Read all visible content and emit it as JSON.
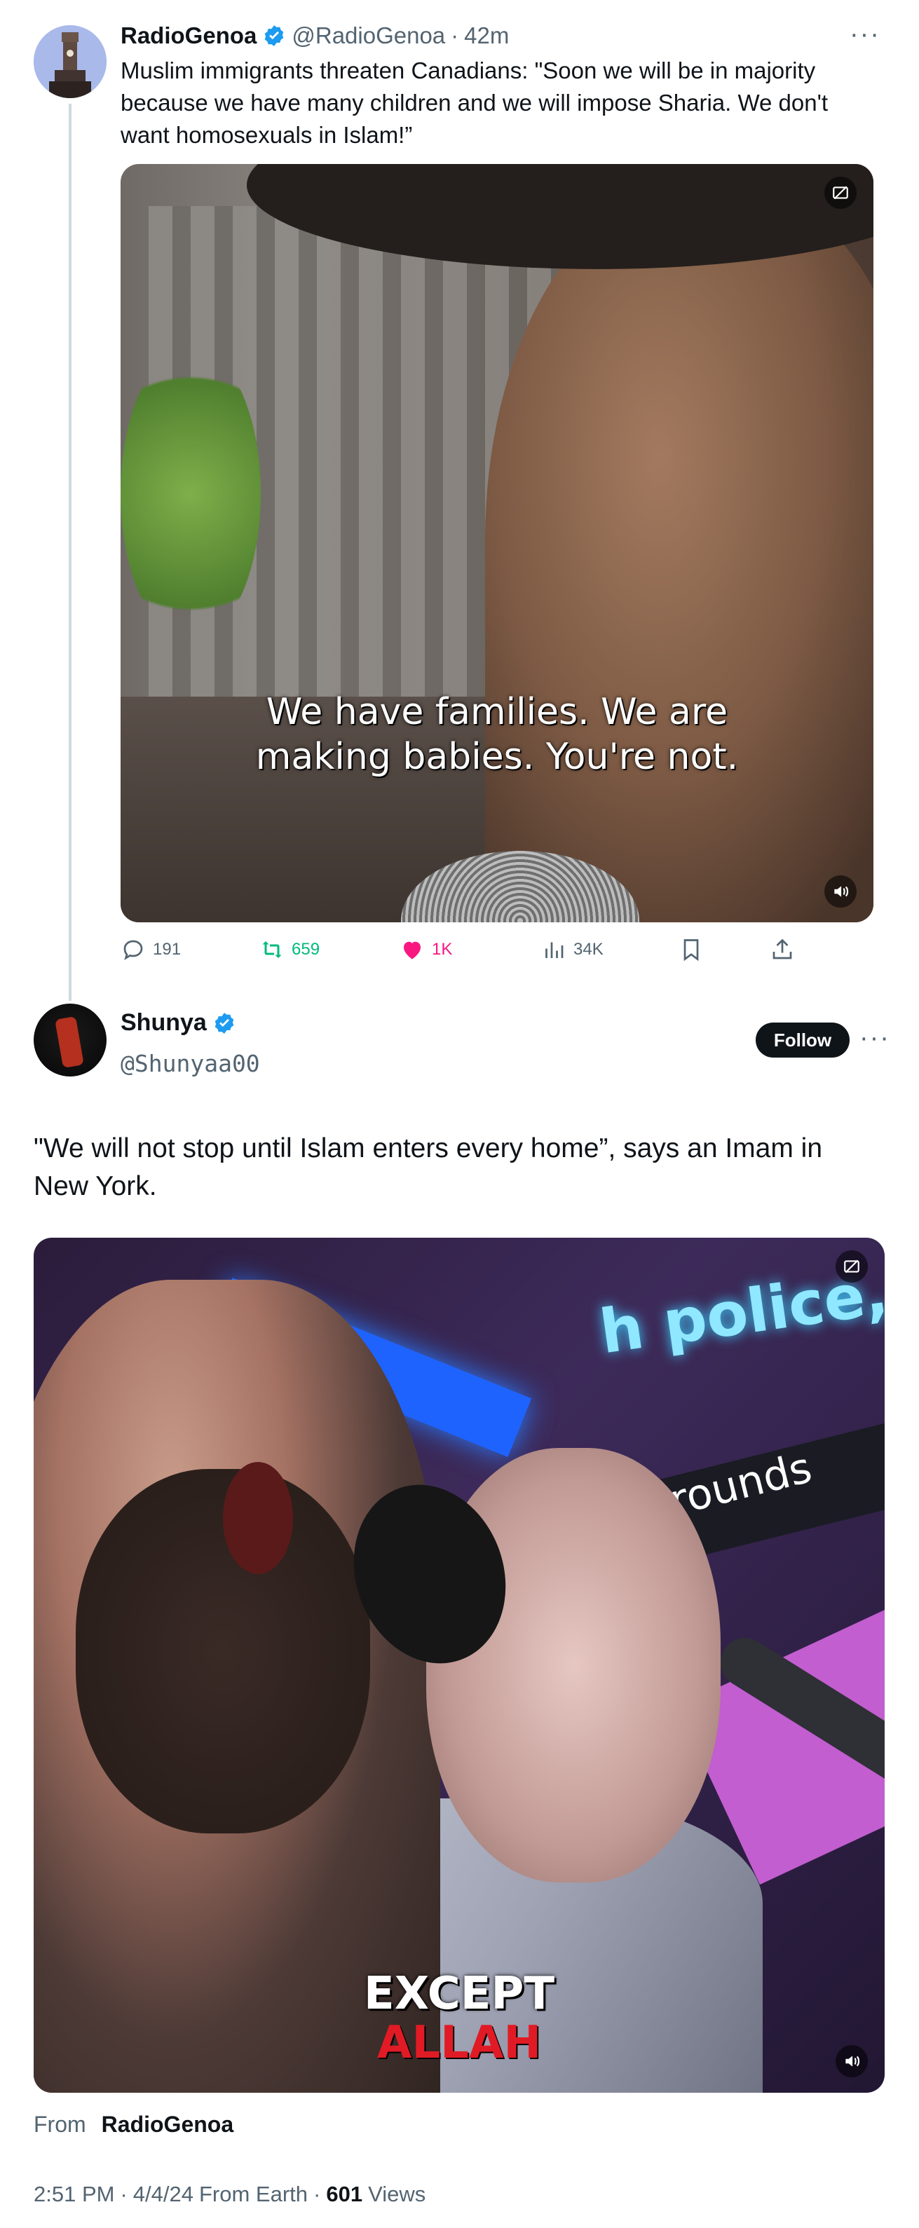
{
  "post1": {
    "display_name": "RadioGenoa",
    "handle": "@RadioGenoa",
    "separator": "·",
    "time": "42m",
    "more_icon": "more-dots-icon",
    "text": "Muslim immigrants threaten Canadians: \"Soon we will be in majority because we have many children and we will impose Sharia. We don't want homosexuals in Islam!”",
    "media_caption_line1": "We have families. We are",
    "media_caption_line2": "making babies. You're not.",
    "actions": {
      "replies": "191",
      "reposts": "659",
      "likes": "1K",
      "views": "34K"
    },
    "colors": {
      "verified": "#1d9bf0",
      "repost_active": "#00ba7c",
      "like_active": "#f91880"
    }
  },
  "post2": {
    "display_name": "Shunya",
    "handle": "@Shunyaa00",
    "follow_label": "Follow",
    "text": "\"We will not stop until Islam enters every home”, says an Imam in New York.",
    "media_sign_text": "h police,",
    "media_sign_text2": "rounds",
    "media_caption_line1": "EXCEPT",
    "media_caption_line2": "ALLAH",
    "from_label": "From",
    "from_name": "RadioGenoa",
    "meta": {
      "time": "2:51 PM",
      "dot": "·",
      "date": "4/4/24",
      "source": "From Earth",
      "views_count": "601",
      "views_label": "Views"
    }
  }
}
